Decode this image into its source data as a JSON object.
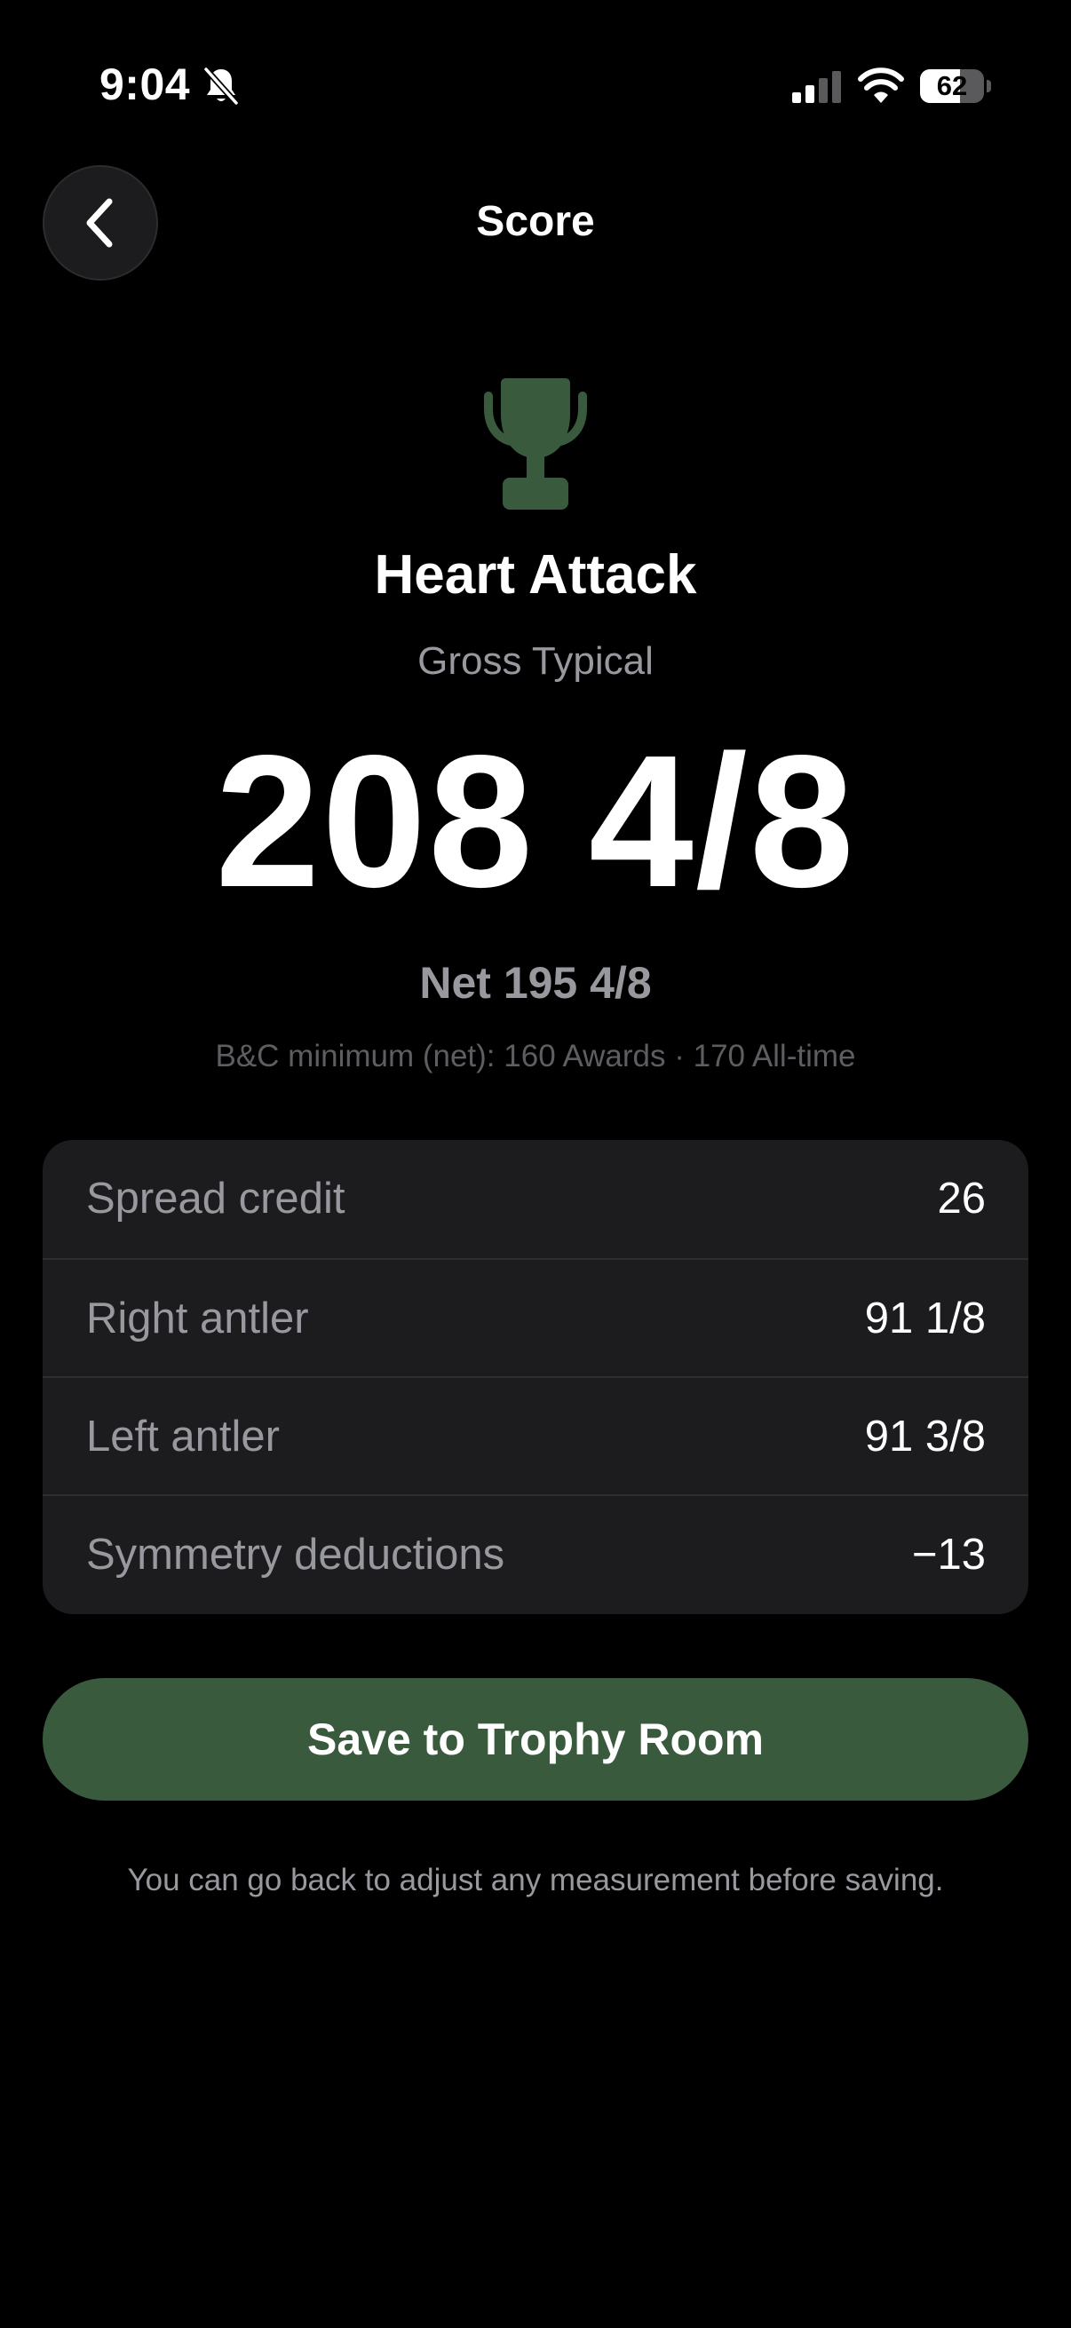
{
  "status_bar": {
    "time": "9:04",
    "bell_icon": "bell-slash-icon",
    "signal_icon": "cellular-signal-icon",
    "wifi_icon": "wifi-icon",
    "battery_level": "62",
    "battery_fraction": 0.62
  },
  "nav": {
    "back_icon": "chevron-left-icon",
    "title": "Score"
  },
  "trophy": {
    "icon": "trophy-icon",
    "icon_color": "#3a5a3e",
    "name": "Heart Attack",
    "score_type": "Gross Typical",
    "gross_score": "208 4/8",
    "net_score": "Net 195 4/8",
    "bc_minimum": "B&C minimum (net): 160 Awards · 170 All-time"
  },
  "breakdown": {
    "rows": [
      {
        "label": "Spread credit",
        "value": "26"
      },
      {
        "label": "Right antler",
        "value": "91 1/8"
      },
      {
        "label": "Left antler",
        "value": "91 3/8"
      },
      {
        "label": "Symmetry deductions",
        "value": "−13"
      }
    ]
  },
  "actions": {
    "save_label": "Save to Trophy Room",
    "save_color": "#3a5a3e",
    "footer_note": "You can go back to adjust any measurement before saving."
  }
}
